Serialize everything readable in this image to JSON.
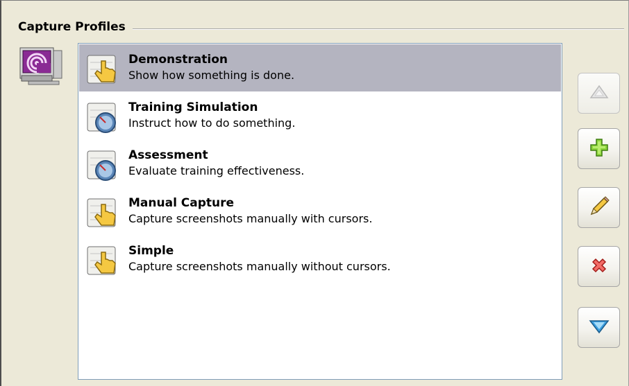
{
  "group": {
    "title": "Capture Profiles"
  },
  "app_icon": "monitor-capture-icon",
  "profiles": [
    {
      "title": "Demonstration",
      "description": "Show how something is done.",
      "icon": "hand-pointer-icon",
      "selected": true
    },
    {
      "title": "Training Simulation",
      "description": "Instruct how to do something.",
      "icon": "gauge-icon",
      "selected": false
    },
    {
      "title": "Assessment",
      "description": "Evaluate training effectiveness.",
      "icon": "gauge-icon",
      "selected": false
    },
    {
      "title": "Manual Capture",
      "description": "Capture screenshots manually with cursors.",
      "icon": "hand-pointer-icon",
      "selected": false
    },
    {
      "title": "Simple",
      "description": "Capture screenshots manually without cursors.",
      "icon": "hand-pointer-icon",
      "selected": false
    }
  ],
  "buttons": [
    {
      "name": "move-up-button",
      "icon": "up-arrow-icon",
      "enabled": false
    },
    {
      "name": "add-button",
      "icon": "plus-icon",
      "enabled": true
    },
    {
      "name": "edit-button",
      "icon": "pencil-icon",
      "enabled": true
    },
    {
      "name": "delete-button",
      "icon": "red-x-icon",
      "enabled": true
    },
    {
      "name": "move-down-button",
      "icon": "down-arrow-icon",
      "enabled": true
    }
  ],
  "colors": {
    "background": "#ece9d8",
    "selection": "#b4b4c0",
    "list_border": "#7f9db9",
    "plus_green": "#8cd43c",
    "delete_red": "#e0302c",
    "arrow_blue": "#3c9fe0",
    "pencil_yellow": "#f5c842"
  }
}
